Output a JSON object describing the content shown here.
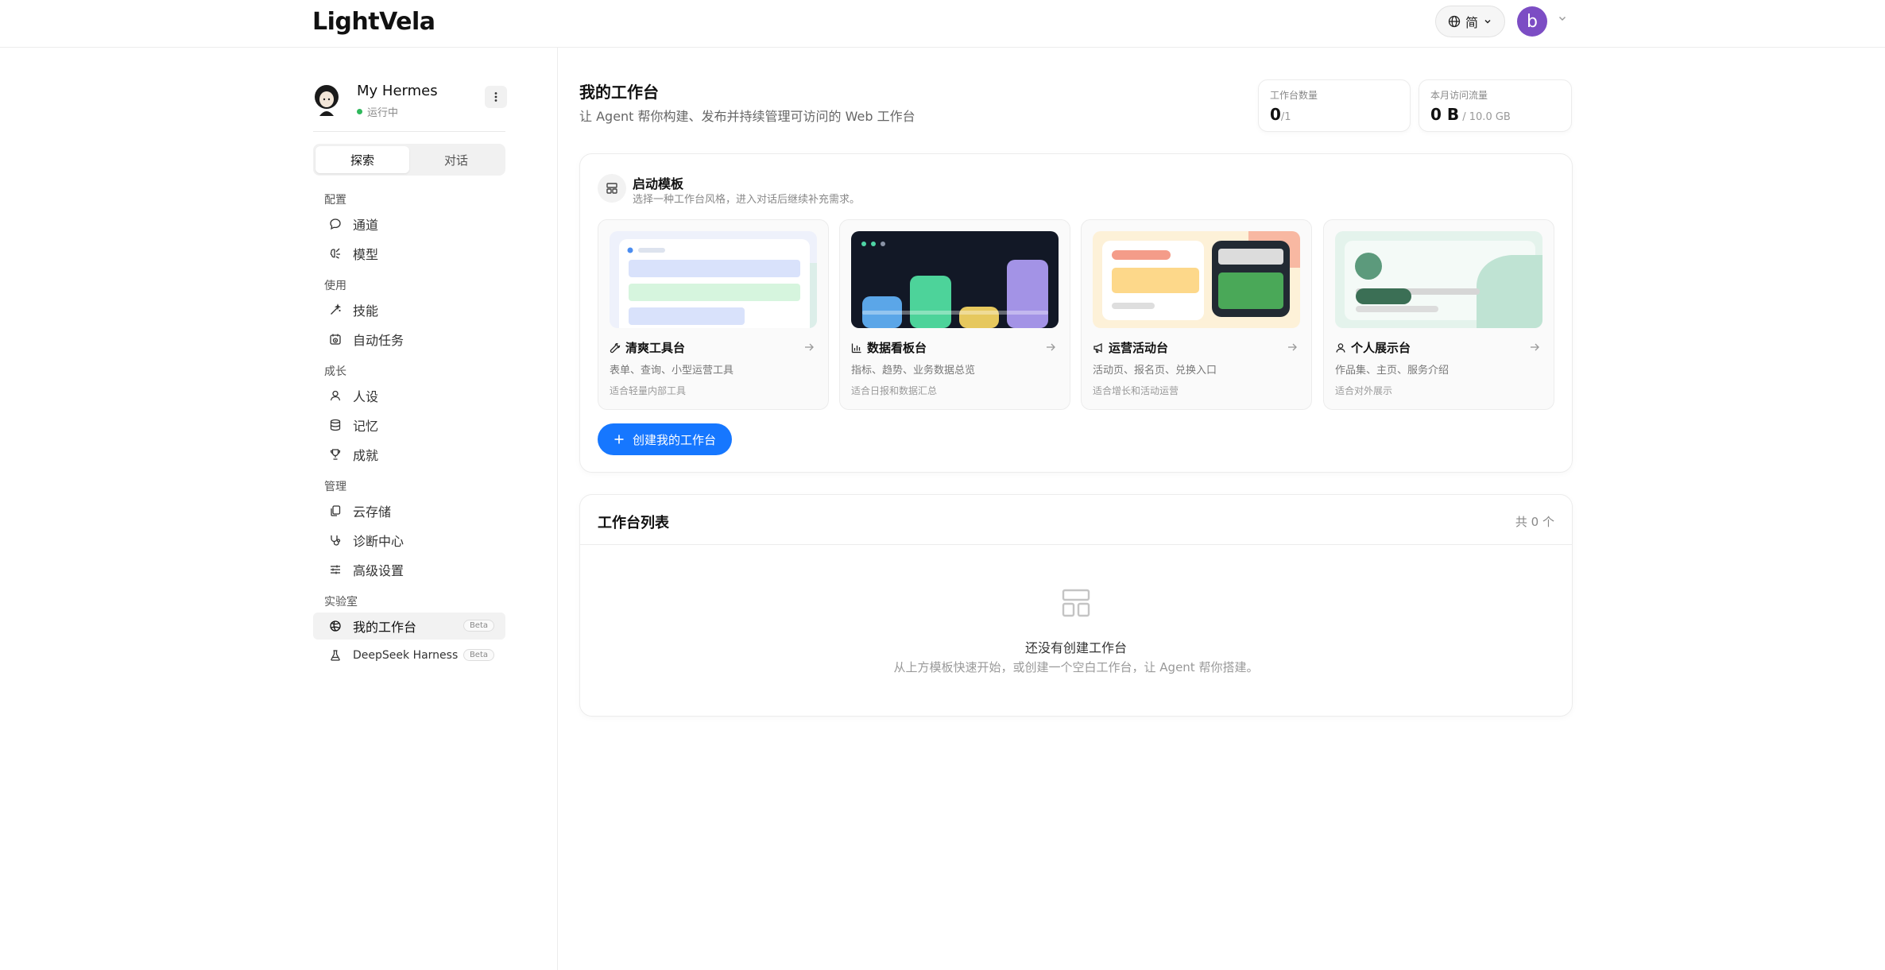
{
  "header": {
    "logo": "LightVela",
    "lang_label": "简",
    "avatar_letter": "b"
  },
  "sidebar": {
    "agent_name": "My Hermes",
    "agent_status": "运行中",
    "tabs": [
      "探索",
      "对话"
    ],
    "groups": {
      "config": "配置",
      "use": "使用",
      "growth": "成长",
      "manage": "管理",
      "lab": "实验室"
    },
    "items": {
      "channel": "通道",
      "model": "模型",
      "skills": "技能",
      "auto_tasks": "自动任务",
      "persona": "人设",
      "memory": "记忆",
      "achievements": "成就",
      "cloud": "云存储",
      "diagnostics": "诊断中心",
      "advanced": "高级设置",
      "workspace": "我的工作台",
      "deepseek": "DeepSeek Harness"
    },
    "beta": "Beta"
  },
  "main": {
    "title": "我的工作台",
    "subtitle": "让 Agent 帮你构建、发布并持续管理可访问的 Web 工作台",
    "stats": {
      "count_label": "工作台数量",
      "count_value": "0",
      "count_total": "/1",
      "traffic_label": "本月访问流量",
      "traffic_value": "0 B",
      "traffic_total": " / 10.0 GB"
    },
    "templates": {
      "title": "启动模板",
      "subtitle": "选择一种工作台风格，进入对话后继续补充需求。",
      "items": [
        {
          "name": "清爽工具台",
          "desc": "表单、查询、小型运营工具",
          "fit": "适合轻量内部工具"
        },
        {
          "name": "数据看板台",
          "desc": "指标、趋势、业务数据总览",
          "fit": "适合日报和数据汇总"
        },
        {
          "name": "运营活动台",
          "desc": "活动页、报名页、兑换入口",
          "fit": "适合增长和活动运营"
        },
        {
          "name": "个人展示台",
          "desc": "作品集、主页、服务介绍",
          "fit": "适合对外展示"
        }
      ],
      "create_label": "创建我的工作台"
    },
    "list": {
      "title": "工作台列表",
      "count": "共 0 个",
      "empty_title": "还没有创建工作台",
      "empty_sub": "从上方模板快速开始，或创建一个空白工作台，让 Agent 帮你搭建。"
    }
  },
  "colors": {
    "primary": "#1677ff",
    "avatar": "#7c4dc4",
    "status": "#2fb85c"
  }
}
